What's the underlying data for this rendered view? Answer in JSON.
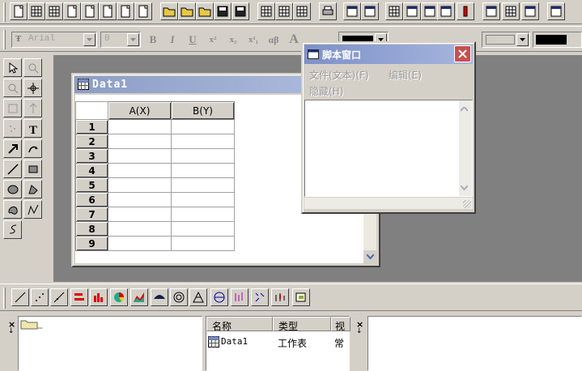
{
  "toolbar_top": {
    "buttons": [
      "new-project",
      "new-worksheet",
      "new-excel",
      "new-graph",
      "new-matrix",
      "new-function",
      "new-layout",
      "new-notes",
      "open",
      "open-template",
      "open-excel",
      "save",
      "save-template",
      "import-single-ascii",
      "import-multiple-ascii",
      "import-wizard",
      "print",
      "duplicate",
      "refresh",
      "project-explorer",
      "results-log",
      "script-window",
      "code-builder",
      "add-new-columns"
    ]
  },
  "format_toolbar": {
    "font_value": "Arial",
    "size_value": "0",
    "bold": "B",
    "italic": "I",
    "underline": "U",
    "superscript": "x²",
    "subscript": "x₂",
    "supsub": "x¹₁",
    "greek": "αβ",
    "increase_font": "A"
  },
  "worksheet": {
    "title": "Data1",
    "columns": [
      "A(X)",
      "B(Y)"
    ],
    "rows": [
      "1",
      "2",
      "3",
      "4",
      "5",
      "6",
      "7",
      "8",
      "9"
    ]
  },
  "script_window": {
    "title": "脚本窗口",
    "menu": [
      "文件(文本)(F)",
      "编辑(E)"
    ],
    "hide": "隐藏(H)"
  },
  "project_explorer": {
    "headers": [
      "名称",
      "类型",
      "视"
    ],
    "rows": [
      {
        "name": "Data1",
        "type": "工作表",
        "view": "常"
      }
    ]
  },
  "colors": {
    "face": "#d4d0c8",
    "mdi_bg": "#808080",
    "title_inactive": "#8c9dc6",
    "title_active": "#7d90c8",
    "close_red": "#c75050"
  }
}
